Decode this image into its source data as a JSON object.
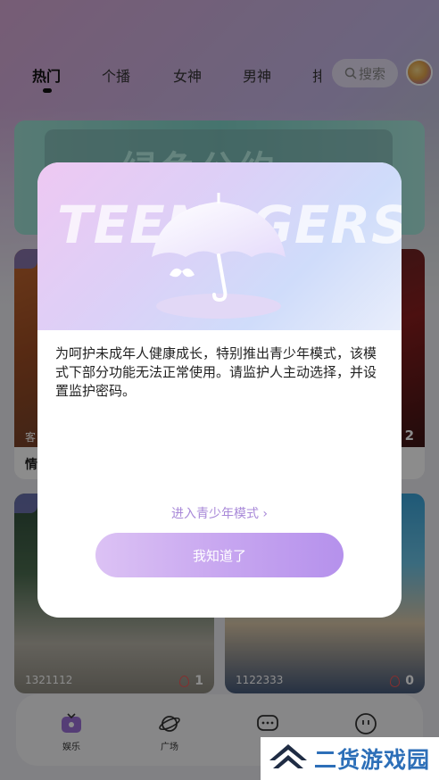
{
  "tabs": [
    {
      "label": "热门"
    },
    {
      "label": "个播"
    },
    {
      "label": "女神"
    },
    {
      "label": "男神"
    },
    {
      "label": "排"
    }
  ],
  "search": {
    "label": "搜索"
  },
  "banner": {
    "text": "绿色公约"
  },
  "cards": [
    {
      "overlay": "客",
      "label": "情"
    },
    {
      "likes_partial": "2"
    },
    {
      "count": "1321112",
      "likes": "1"
    },
    {
      "count": "1122333",
      "likes": "0"
    }
  ],
  "nav": [
    {
      "label": "娱乐"
    },
    {
      "label": "广场"
    },
    {
      "label": ""
    },
    {
      "label": ""
    }
  ],
  "modal": {
    "hero_word": "TEENAGERS",
    "message": "为呵护未成年人健康成长，特别推出青少年模式，该模式下部分功能无法正常使用。请监护人主动选择，并设置监护密码。",
    "enter_link": "进入青少年模式",
    "ok_button": "我知道了"
  },
  "watermark": {
    "text": "二货游戏园"
  },
  "colors": {
    "accent": "#b591ec",
    "link": "#a888d8",
    "like_flame": "#f05656",
    "watermark": "#2d6fb8"
  }
}
